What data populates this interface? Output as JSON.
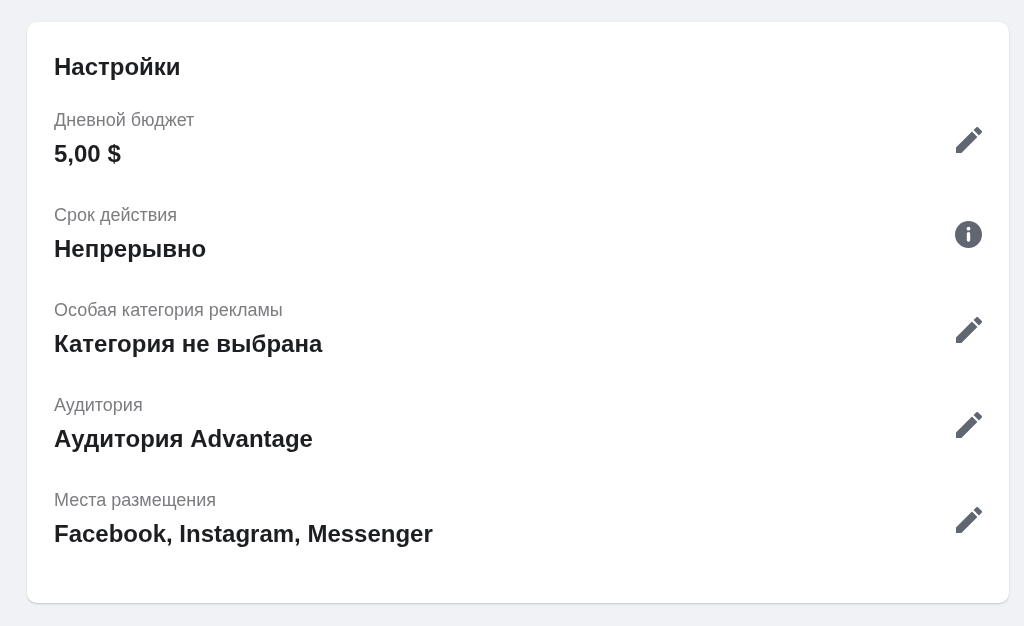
{
  "settings_card": {
    "title": "Настройки",
    "rows": [
      {
        "label": "Дневной бюджет",
        "value": "5,00 $",
        "kind": "editable"
      },
      {
        "label": "Срок действия",
        "value": "Непрерывно",
        "kind": "informational"
      },
      {
        "label": "Особая категория рекламы",
        "value": "Категория не выбрана",
        "kind": "editable"
      },
      {
        "label": "Аудитория",
        "value": "Аудитория Advantage",
        "kind": "editable"
      },
      {
        "label": "Места размещения",
        "value": "Facebook, Instagram, Messenger",
        "kind": "editable"
      }
    ]
  }
}
